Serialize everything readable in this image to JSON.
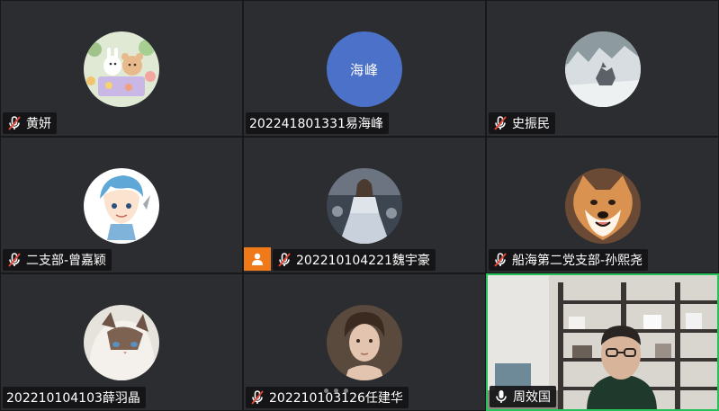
{
  "participants": [
    {
      "name": "黄妍",
      "muted": true,
      "avatar": "picnic-bunny-bear-illustration"
    },
    {
      "name": "202241801331易海峰",
      "muted": false,
      "avatar_text": "海峰",
      "avatar_color": "#4b72c8"
    },
    {
      "name": "史振民",
      "muted": true,
      "avatar": "wolf-in-snow-photo"
    },
    {
      "name": "二支部-曾嘉颖",
      "muted": true,
      "avatar": "blue-hair-anime-boy"
    },
    {
      "name": "202210104221魏宇豪",
      "muted": true,
      "avatar": "fantasy-princess-photo",
      "host_badge": true
    },
    {
      "name": "船海第二党支部-孙熙尧",
      "muted": true,
      "avatar": "smiling-shiba-dog"
    },
    {
      "name": "202210104103薛羽晶",
      "muted": false,
      "avatar": "ragdoll-cat-photo"
    },
    {
      "name": "202210103126任建华",
      "muted": true,
      "avatar": "young-man-portrait"
    },
    {
      "name": "周效国",
      "muted": false,
      "video_on": true,
      "speaking": true
    }
  ],
  "colors": {
    "speaking_border": "#27c15a",
    "muted_icon": "#e2463a",
    "host_badge": "#f07a1a"
  }
}
